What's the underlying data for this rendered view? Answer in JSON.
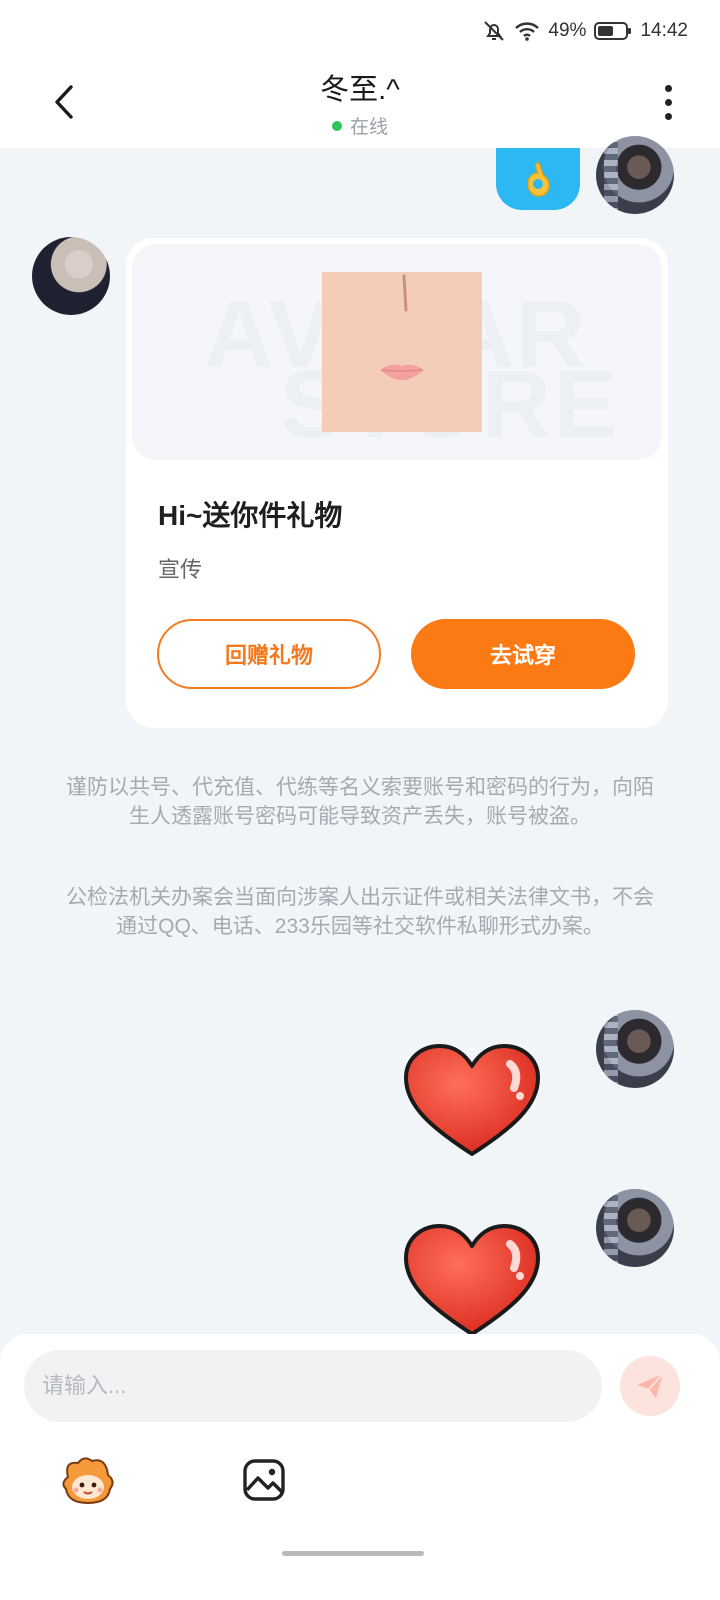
{
  "status_bar": {
    "battery": "49%",
    "time": "14:42"
  },
  "header": {
    "title": "冬至.^",
    "status": "在线"
  },
  "gift_card": {
    "watermark_line1": "AVATAR",
    "watermark_line2": "STORE",
    "title": "Hi~送你件礼物",
    "subtitle": "宣传",
    "return_gift_label": "回赠礼物",
    "try_on_label": "去试穿"
  },
  "notices": [
    "谨防以共号、代充值、代练等名义索要账号和密码的行为，向陌生人透露账号密码可能导致资产丢失，账号被盗。",
    "公检法机关办案会当面向涉案人出示证件或相关法律文书，不会通过QQ、电话、233乐园等社交软件私聊形式办案。"
  ],
  "composer": {
    "placeholder": "请输入..."
  },
  "colors": {
    "accent": "#fb7a14",
    "online": "#2fc45a",
    "ok_bubble": "#2cb8f2"
  },
  "icons": [
    "bell-off-icon",
    "wifi-icon",
    "battery-icon",
    "back-icon",
    "more-icon",
    "ok-hand-icon",
    "heart-sticker",
    "send-icon",
    "mascot-emoji-icon",
    "image-icon"
  ]
}
